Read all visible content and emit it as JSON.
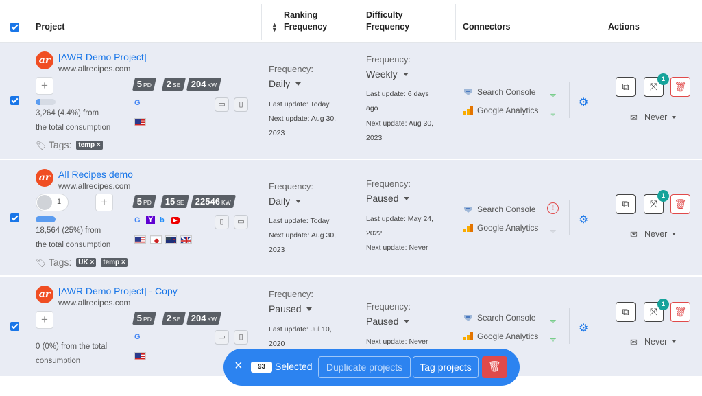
{
  "header": {
    "project": "Project",
    "ranking": [
      "Ranking",
      "Frequency"
    ],
    "difficulty": [
      "Difficulty",
      "Frequency"
    ],
    "connectors": "Connectors",
    "actions": "Actions",
    "sort_icon": "sort-arrows-icon"
  },
  "colors": {
    "accent": "#1976e8",
    "row_bg": "#e9ecf4",
    "logo": "#f04e23",
    "danger": "#e04a4a",
    "badge": "#16a39b",
    "plug_ok": "#57c46b"
  },
  "projects": [
    {
      "name": "[AWR Demo Project]",
      "url": "www.allrecipes.com",
      "logo": "ar",
      "pd": "5",
      "pd_unit": "PD",
      "se": "2",
      "se_unit": "SE",
      "kw": "204",
      "kw_unit": "KW",
      "consumption_pct": 0.044,
      "consumption": [
        "3,264 (4.4%) from",
        "the total consumption"
      ],
      "tags_label": "Tags:",
      "tags": [
        "temp ×"
      ],
      "engines": [
        "google-icon"
      ],
      "flags": [
        "us-flag-icon"
      ],
      "ranking": {
        "label": "Frequency:",
        "value": "Daily",
        "last": "Last update:  Today",
        "next": [
          "Next update:  Aug 30,",
          "2023"
        ]
      },
      "difficulty": {
        "label": "Frequency:",
        "value": "Weekly",
        "last": [
          "Last update:  6 days",
          "ago"
        ],
        "next": [
          "Next update:  Aug 30,",
          "2023"
        ]
      },
      "connectors": [
        {
          "name": "Search Console",
          "status": "connected"
        },
        {
          "name": "Google Analytics",
          "status": "connected"
        }
      ],
      "share_count": "1",
      "notify": "Never"
    },
    {
      "name": "All Recipes demo",
      "url": "www.allrecipes.com",
      "logo": "ar",
      "user_count": "1",
      "pd": "5",
      "pd_unit": "PD",
      "se": "15",
      "se_unit": "SE",
      "kw": "22546",
      "kw_unit": "KW",
      "consumption_pct": 0.25,
      "consumption": [
        "18,564 (25%) from",
        "the total consumption"
      ],
      "tags_label": "Tags:",
      "tags": [
        "UK ×",
        "temp ×"
      ],
      "engines": [
        "google-icon",
        "yahoo-icon",
        "bing-icon",
        "youtube-icon"
      ],
      "flags": [
        "us-flag-icon",
        "japan-flag-icon",
        "nz-flag-icon",
        "uk-flag-icon"
      ],
      "ranking": {
        "label": "Frequency:",
        "value": "Daily",
        "last": "Last update:  Today",
        "next": [
          "Next update:  Aug 30,",
          "2023"
        ]
      },
      "difficulty": {
        "label": "Frequency:",
        "value": "Paused",
        "last": [
          "Last update:  May 24,",
          "2022"
        ],
        "next": [
          "Next update:  Never"
        ]
      },
      "connectors": [
        {
          "name": "Search Console",
          "status": "error"
        },
        {
          "name": "Google Analytics",
          "status": "disconnected"
        }
      ],
      "share_count": "1",
      "notify": "Never"
    },
    {
      "name": "[AWR Demo Project] - Copy",
      "url": "www.allrecipes.com",
      "logo": "ar",
      "pd": "5",
      "pd_unit": "PD",
      "se": "2",
      "se_unit": "SE",
      "kw": "204",
      "kw_unit": "KW",
      "consumption_pct": 0,
      "consumption": [
        "0 (0%) from the total",
        "consumption"
      ],
      "engines": [
        "google-icon"
      ],
      "flags": [
        "us-flag-icon"
      ],
      "ranking": {
        "label": "Frequency:",
        "value": "Paused",
        "last": "Last update:  Jul 10,",
        "next": [
          "2020"
        ]
      },
      "difficulty": {
        "label": "Frequency:",
        "value": "Paused",
        "last": [
          "Next update:  Never"
        ],
        "next": []
      },
      "connectors": [
        {
          "name": "Search Console",
          "status": "connected"
        },
        {
          "name": "Google Analytics",
          "status": "connected"
        }
      ],
      "share_count": "1",
      "notify": "Never"
    }
  ],
  "selection_bar": {
    "count": "93",
    "selected_label": "Selected",
    "duplicate": "Duplicate projects",
    "tag": "Tag projects"
  }
}
